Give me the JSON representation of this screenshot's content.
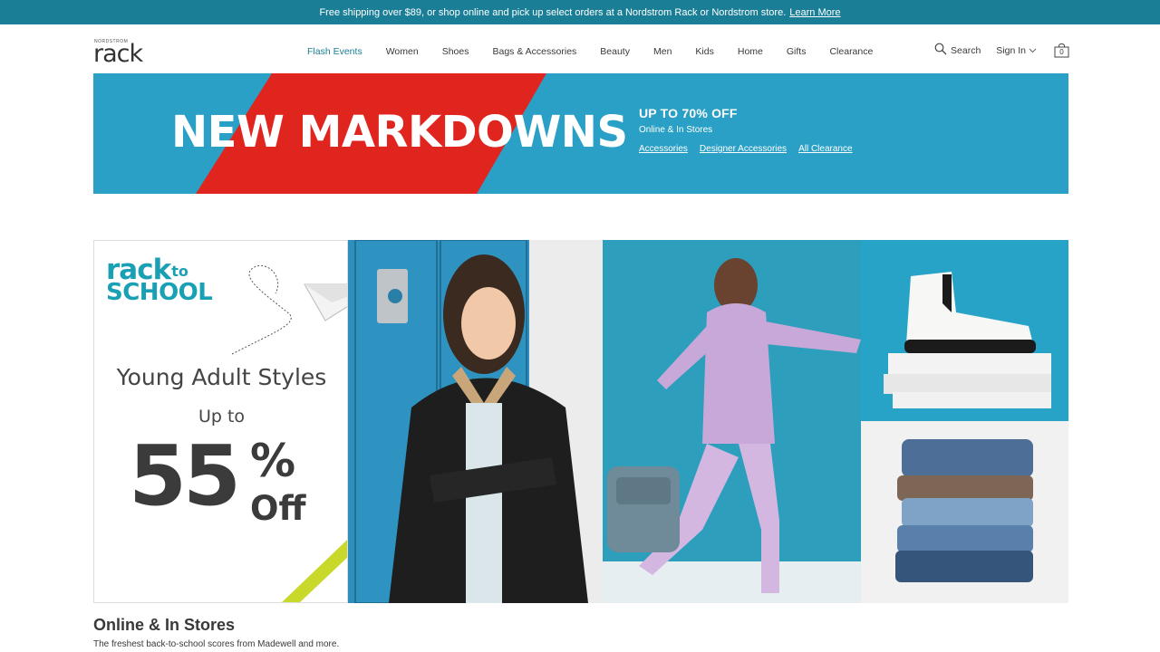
{
  "promo": {
    "text": "Free shipping over $89, or shop online and pick up select orders at a Nordstrom Rack or Nordstrom store.",
    "link": "Learn More"
  },
  "logo": {
    "small": "NORDSTROM",
    "big": "rack"
  },
  "nav": {
    "items": [
      {
        "label": "Flash Events",
        "active": true
      },
      {
        "label": "Women"
      },
      {
        "label": "Shoes"
      },
      {
        "label": "Bags & Accessories"
      },
      {
        "label": "Beauty"
      },
      {
        "label": "Men"
      },
      {
        "label": "Kids"
      },
      {
        "label": "Home"
      },
      {
        "label": "Gifts"
      },
      {
        "label": "Clearance"
      }
    ]
  },
  "utility": {
    "search": "Search",
    "signin": "Sign In",
    "bag_count": "0"
  },
  "hero": {
    "title": "NEW MARKDOWNS",
    "headline": "UP TO 70% OFF",
    "subline": "Online & In Stores",
    "links": [
      "Accessories",
      "Designer Accessories",
      "All Clearance"
    ]
  },
  "school": {
    "logo_line1": "rack",
    "logo_to": "to",
    "logo_line2": "SCHOOL",
    "heading": "Young Adult Styles",
    "upto": "Up to",
    "percent": "55",
    "pct_sign": "%",
    "off": "Off"
  },
  "section": {
    "title": "Online & In Stores",
    "subtitle": "The freshest back-to-school scores from Madewell and more."
  },
  "colors": {
    "brand_teal": "#1a7f96",
    "hero_blue": "#2aa0c6",
    "hero_red": "#e0251f",
    "school_teal": "#1aa0b4"
  }
}
